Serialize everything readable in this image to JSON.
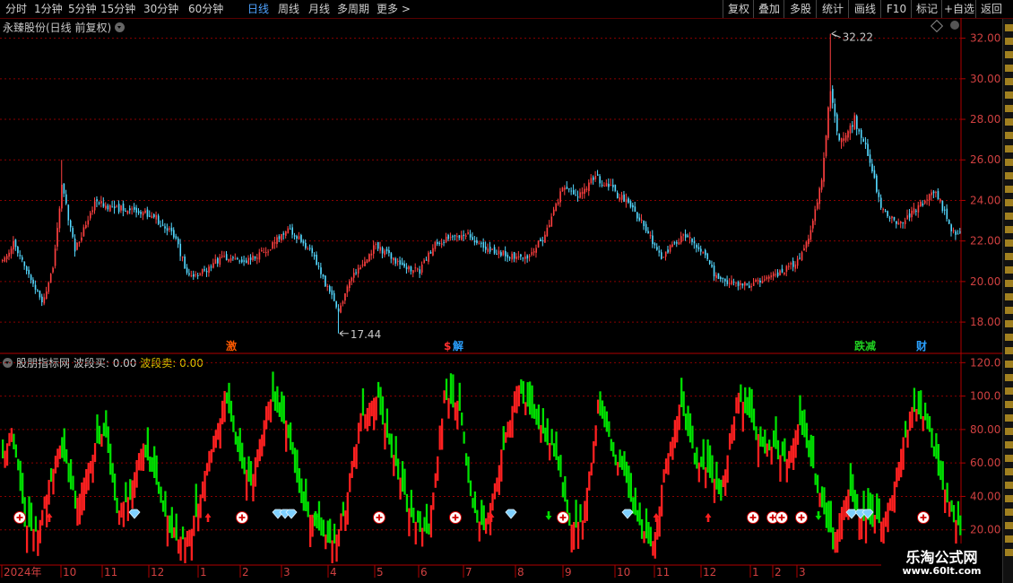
{
  "toolbar": {
    "tabs": [
      {
        "label": "分时",
        "active": false
      },
      {
        "label": "1分钟",
        "active": false
      },
      {
        "label": "5分钟",
        "active": false
      },
      {
        "label": "15分钟",
        "active": false
      },
      {
        "label": "30分钟",
        "active": false
      },
      {
        "label": "60分钟",
        "active": false
      },
      {
        "label": "日线",
        "active": true
      },
      {
        "label": "周线",
        "active": false
      },
      {
        "label": "月线",
        "active": false
      },
      {
        "label": "多周期",
        "active": false
      },
      {
        "label": "更多 >",
        "active": false
      }
    ],
    "right_buttons": [
      "复权",
      "叠加",
      "多股",
      "统计",
      "画线",
      "F10",
      "标记",
      "+自选",
      "返回"
    ]
  },
  "main_chart": {
    "title": "永臻股份(日线 前复权)",
    "y_ticks": [
      "32.00",
      "30.00",
      "28.00",
      "26.00",
      "24.00",
      "22.00",
      "20.00",
      "18.00"
    ],
    "high_label": "32.22",
    "low_label": "17.44",
    "event_markers": [
      {
        "label": "激",
        "color": "#ff5a00"
      },
      {
        "label": "$",
        "color": "#ff3030"
      },
      {
        "label": "解",
        "color": "#2aa0ff"
      },
      {
        "label": "跌减",
        "color": "#20d020"
      },
      {
        "label": "财",
        "color": "#2aa0ff"
      }
    ]
  },
  "indicator": {
    "name": "股朋指标网",
    "label_1": "波段买:",
    "value_1": "0.00",
    "label_2": "波段卖:",
    "value_2": "0.00",
    "y_ticks": [
      "120.0",
      "100.0",
      "80.00",
      "60.00",
      "40.00",
      "20.00"
    ]
  },
  "x_axis": {
    "labels": [
      "2024年",
      "10",
      "11",
      "12",
      "1",
      "2",
      "3",
      "4",
      "5",
      "6",
      "7",
      "8",
      "9",
      "10",
      "11",
      "12",
      "1",
      "2",
      "3"
    ]
  },
  "watermark": {
    "title": "乐淘公式网",
    "url": "www.60lt.com"
  },
  "colors": {
    "up": "#ff2020",
    "down": "#00e000",
    "candle_up": "#ff4040",
    "candle_down": "#54d8ff",
    "grid": "#8a0000",
    "active_tab": "#4fa3ff"
  },
  "chart_data": {
    "type": "candlestick",
    "price_range": [
      16.5,
      33.0
    ],
    "indicator_range": [
      0,
      125
    ],
    "high": 32.22,
    "low": 17.44,
    "close_path_anchors": [
      [
        0,
        21.0
      ],
      [
        5,
        21.9
      ],
      [
        12,
        20.4
      ],
      [
        18,
        19.0
      ],
      [
        23,
        20.6
      ],
      [
        27,
        24.8
      ],
      [
        33,
        21.5
      ],
      [
        42,
        23.9
      ],
      [
        51,
        23.6
      ],
      [
        60,
        23.6
      ],
      [
        70,
        23.1
      ],
      [
        78,
        22.3
      ],
      [
        85,
        20.2
      ],
      [
        93,
        20.6
      ],
      [
        100,
        21.2
      ],
      [
        110,
        21.0
      ],
      [
        120,
        21.5
      ],
      [
        130,
        22.6
      ],
      [
        140,
        21.6
      ],
      [
        147,
        19.9
      ],
      [
        153,
        18.6
      ],
      [
        160,
        20.4
      ],
      [
        170,
        21.8
      ],
      [
        180,
        20.9
      ],
      [
        190,
        20.5
      ],
      [
        197,
        21.9
      ],
      [
        205,
        22.2
      ],
      [
        212,
        22.3
      ],
      [
        220,
        21.7
      ],
      [
        230,
        21.3
      ],
      [
        240,
        21.2
      ],
      [
        248,
        22.5
      ],
      [
        255,
        24.6
      ],
      [
        262,
        24.3
      ],
      [
        270,
        25.2
      ],
      [
        278,
        24.5
      ],
      [
        285,
        23.8
      ],
      [
        292,
        22.8
      ],
      [
        300,
        21.2
      ],
      [
        310,
        22.3
      ],
      [
        318,
        21.6
      ],
      [
        326,
        20.0
      ],
      [
        340,
        19.8
      ],
      [
        355,
        20.5
      ],
      [
        362,
        21.0
      ],
      [
        368,
        22.5
      ],
      [
        373,
        25.0
      ],
      [
        377,
        29.5
      ],
      [
        381,
        26.8
      ],
      [
        388,
        28.0
      ],
      [
        395,
        26.0
      ],
      [
        400,
        23.5
      ],
      [
        408,
        22.8
      ],
      [
        418,
        23.8
      ],
      [
        425,
        24.5
      ],
      [
        432,
        22.5
      ],
      [
        436,
        22.3
      ]
    ],
    "indicator_anchors": [
      [
        0,
        65
      ],
      [
        4,
        80
      ],
      [
        10,
        25
      ],
      [
        15,
        15
      ],
      [
        20,
        42
      ],
      [
        26,
        72
      ],
      [
        33,
        35
      ],
      [
        40,
        62
      ],
      [
        46,
        80
      ],
      [
        52,
        30
      ],
      [
        58,
        40
      ],
      [
        63,
        72
      ],
      [
        70,
        48
      ],
      [
        76,
        20
      ],
      [
        82,
        14
      ],
      [
        88,
        28
      ],
      [
        95,
        70
      ],
      [
        101,
        100
      ],
      [
        108,
        60
      ],
      [
        113,
        48
      ],
      [
        121,
        100
      ],
      [
        129,
        84
      ],
      [
        136,
        36
      ],
      [
        143,
        22
      ],
      [
        150,
        12
      ],
      [
        156,
        35
      ],
      [
        163,
        90
      ],
      [
        170,
        100
      ],
      [
        178,
        62
      ],
      [
        186,
        25
      ],
      [
        194,
        20
      ],
      [
        201,
        102
      ],
      [
        208,
        92
      ],
      [
        214,
        30
      ],
      [
        219,
        18
      ],
      [
        226,
        60
      ],
      [
        234,
        105
      ],
      [
        240,
        92
      ],
      [
        246,
        76
      ],
      [
        252,
        62
      ],
      [
        258,
        20
      ],
      [
        264,
        24
      ],
      [
        271,
        94
      ],
      [
        278,
        66
      ],
      [
        284,
        45
      ],
      [
        290,
        20
      ],
      [
        296,
        10
      ],
      [
        302,
        62
      ],
      [
        308,
        96
      ],
      [
        315,
        60
      ],
      [
        321,
        54
      ],
      [
        327,
        40
      ],
      [
        334,
        100
      ],
      [
        340,
        88
      ],
      [
        345,
        70
      ],
      [
        351,
        68
      ],
      [
        357,
        62
      ],
      [
        363,
        84
      ],
      [
        368,
        60
      ],
      [
        373,
        35
      ],
      [
        378,
        10
      ],
      [
        384,
        44
      ],
      [
        390,
        30
      ],
      [
        396,
        25
      ],
      [
        402,
        28
      ],
      [
        408,
        60
      ],
      [
        414,
        95
      ],
      [
        420,
        85
      ],
      [
        426,
        55
      ],
      [
        432,
        30
      ],
      [
        436,
        20
      ]
    ]
  }
}
